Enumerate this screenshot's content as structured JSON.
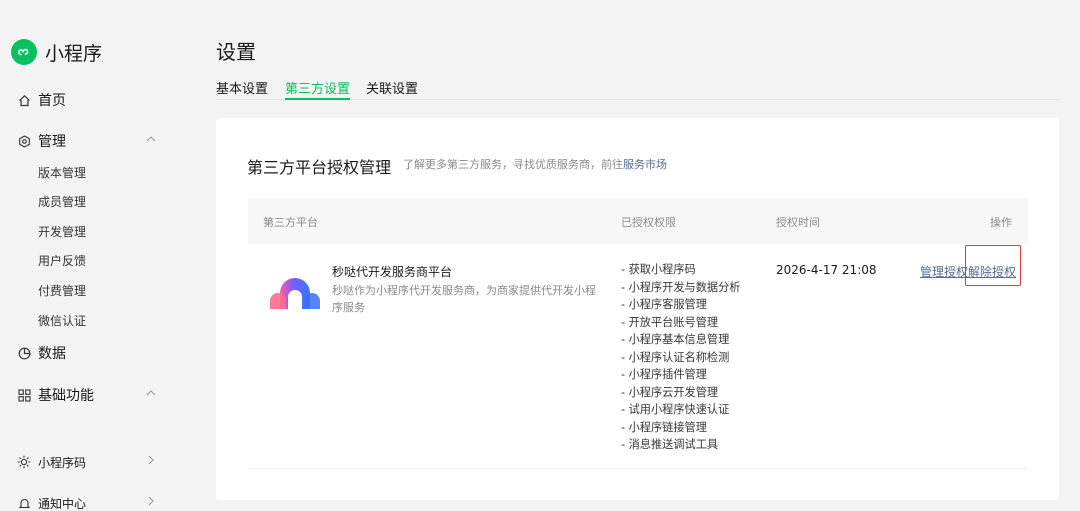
{
  "app": {
    "name": "小程序",
    "brand_color": "#07c160"
  },
  "sidebar": {
    "home": {
      "label": "首页",
      "icon": "home-icon"
    },
    "manage": {
      "label": "管理",
      "icon": "settings-hex-icon",
      "items": [
        "版本管理",
        "成员管理",
        "开发管理",
        "用户反馈",
        "付费管理",
        "微信认证"
      ]
    },
    "data": {
      "label": "数据",
      "icon": "pie-chart-icon"
    },
    "basic": {
      "label": "基础功能",
      "icon": "grid-icon",
      "faded_item": ""
    },
    "qrcode": {
      "label": "小程序码",
      "icon": "sun-icon"
    },
    "notice": {
      "label": "通知中心",
      "icon": "bell-icon"
    }
  },
  "page": {
    "title": "设置",
    "tabs": [
      {
        "label": "基本设置",
        "active": false
      },
      {
        "label": "第三方设置",
        "active": true
      },
      {
        "label": "关联设置",
        "active": false
      }
    ]
  },
  "card": {
    "title": "第三方平台授权管理",
    "hint_prefix": "了解更多第三方服务，寻找优质服务商，前往",
    "hint_link": "服务市场",
    "columns": [
      "第三方平台",
      "已授权权限",
      "授权时间",
      "操作"
    ],
    "row": {
      "name": "秒哒代开发服务商平台",
      "description": "秒哒作为小程序代开发服务商，为商家提供代开发小程序服务",
      "permissions": [
        "- 获取小程序码",
        "- 小程序开发与数据分析",
        "- 小程序客服管理",
        "- 开放平台账号管理",
        "- 小程序基本信息管理",
        "- 小程序认证名称检测",
        "- 小程序插件管理",
        "- 小程序云开发管理",
        "- 试用小程序快速认证",
        "- 小程序链接管理",
        "- 消息推送调试工具"
      ],
      "auth_time": "2026-4-17 21:08",
      "actions": {
        "manage": "管理授权",
        "revoke": "解除授权"
      }
    }
  },
  "colors": {
    "link": "#576b95",
    "highlight": "#e03a3a"
  }
}
